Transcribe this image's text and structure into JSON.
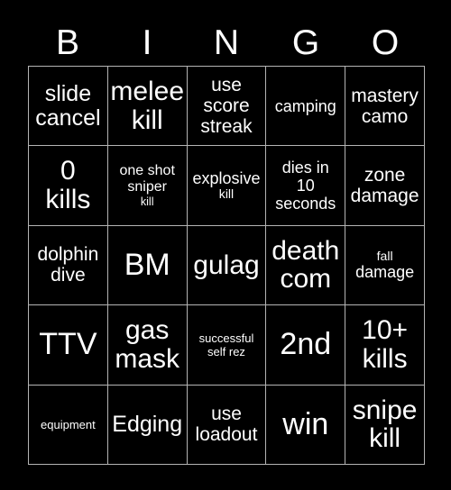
{
  "card": {
    "header_letters": [
      "B",
      "I",
      "N",
      "G",
      "O"
    ],
    "colors": {
      "background": "#000000",
      "text": "#ffffff",
      "grid_line": "#b4b4b4"
    },
    "rows": [
      [
        {
          "text": "slide\ncancel",
          "size": "xl"
        },
        {
          "text": "melee\nkill",
          "size": "xxl"
        },
        {
          "text": "use\nscore\nstreak",
          "size": "lg"
        },
        {
          "text": "camping",
          "size": "md"
        },
        {
          "text": "mastery\ncamo",
          "size": "lg"
        }
      ],
      [
        {
          "text": "0\nkills",
          "size": "xxl"
        },
        {
          "text": "one shot\nsniper\nkill",
          "size": "sm",
          "last_line_small": true
        },
        {
          "text": "explosive\nkill",
          "size": "md",
          "last_line_small": true
        },
        {
          "text": "dies in\n10\nseconds",
          "size": "md"
        },
        {
          "text": "zone\ndamage",
          "size": "lg"
        }
      ],
      [
        {
          "text": "dolphin\ndive",
          "size": "lg"
        },
        {
          "text": "BM",
          "size": "huge"
        },
        {
          "text": "gulag",
          "size": "xxl"
        },
        {
          "text": "death\ncom",
          "size": "xxl"
        },
        {
          "text": "fall\ndamage",
          "size": "md",
          "first_line_small": true
        }
      ],
      [
        {
          "text": "TTV",
          "size": "huge"
        },
        {
          "text": "gas\nmask",
          "size": "xxl"
        },
        {
          "text": "successful\nself rez",
          "size": "xs"
        },
        {
          "text": "2nd",
          "size": "huge"
        },
        {
          "text": "10+\nkills",
          "size": "xxl"
        }
      ],
      [
        {
          "text": "equipment",
          "size": "xs"
        },
        {
          "text": "Edging",
          "size": "xl"
        },
        {
          "text": "use\nloadout",
          "size": "lg"
        },
        {
          "text": "win",
          "size": "huge"
        },
        {
          "text": "snipe\nkill",
          "size": "xxl"
        }
      ]
    ]
  }
}
